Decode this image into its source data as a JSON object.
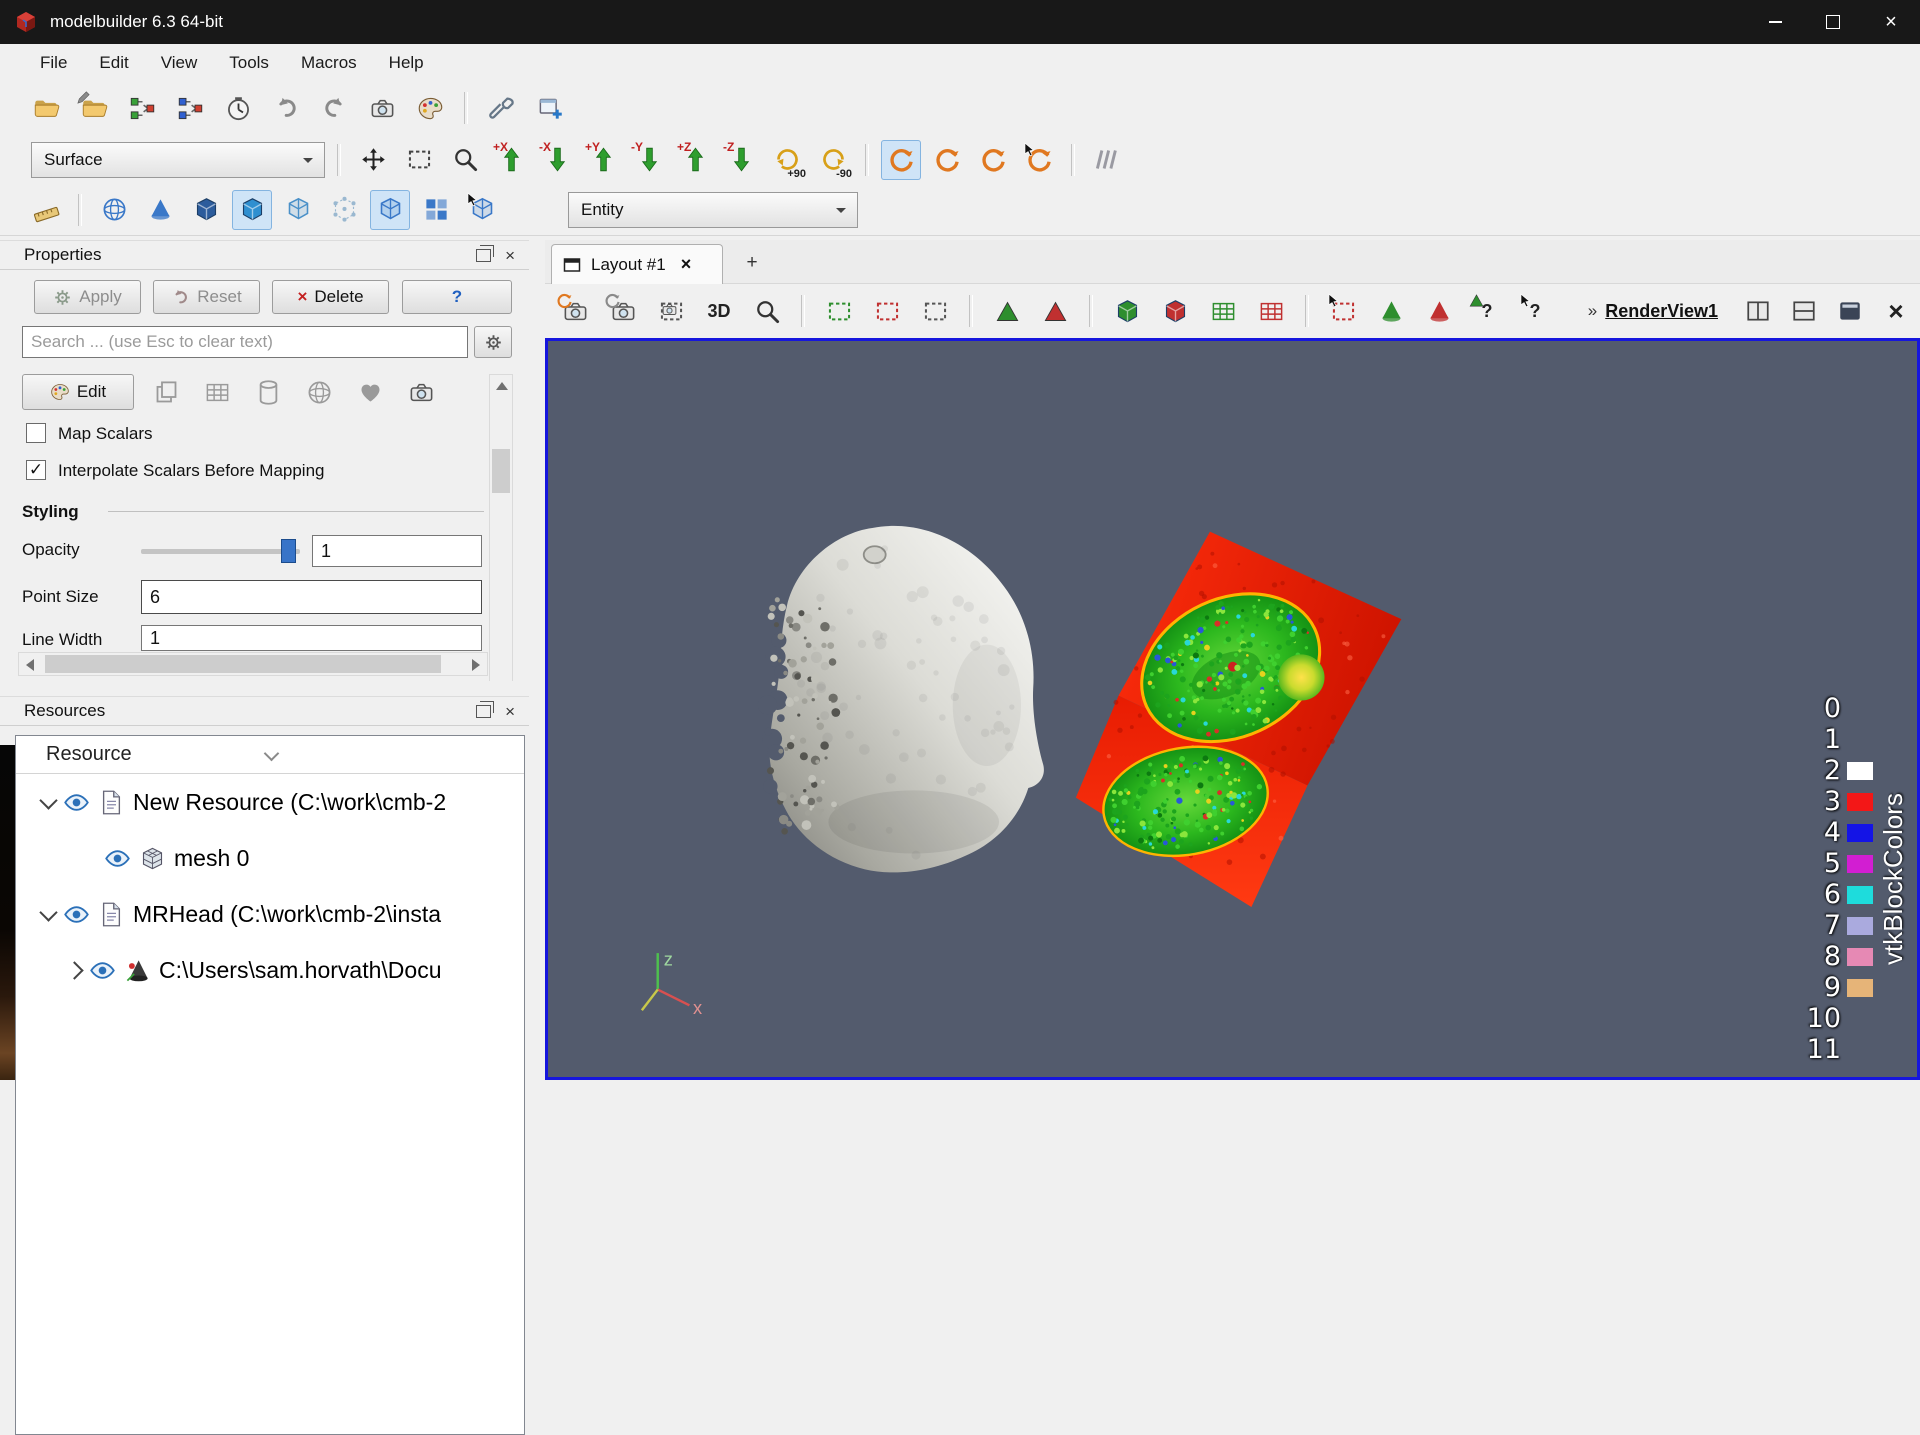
{
  "window": {
    "title": "modelbuilder 6.3 64-bit",
    "controls": {
      "minimize": "minimize",
      "maximize": "maximize",
      "close": "×"
    }
  },
  "menu": {
    "items": [
      "File",
      "Edit",
      "View",
      "Tools",
      "Macros",
      "Help"
    ]
  },
  "toolbars": {
    "representation_value": "Surface",
    "entity_value": "Entity",
    "main": [
      {
        "name": "open-file-button",
        "sym": "s-folder"
      },
      {
        "name": "open-edit-button",
        "sym": "s-folder",
        "overlay": "s-pencil"
      },
      {
        "name": "pipeline-source-button",
        "sym": "s-nodes",
        "color": "#38a038"
      },
      {
        "name": "pipeline-filter-button",
        "sym": "s-nodes",
        "color": "#3060d0"
      },
      {
        "name": "timer-button",
        "sym": "s-clock"
      },
      {
        "name": "undo-button",
        "sym": "s-undo",
        "color": "#8a8a8a"
      },
      {
        "name": "redo-button",
        "sym": "s-undo",
        "color": "#8a8a8a",
        "flip": true
      },
      {
        "name": "camera-link-button",
        "sym": "s-camera"
      },
      {
        "name": "color-palette-button",
        "sym": "s-palette"
      },
      {
        "sep": true
      },
      {
        "name": "tools-wrench-button",
        "sym": "s-wrench"
      },
      {
        "name": "add-view-button",
        "sym": "s-plusdoc"
      }
    ],
    "camera": [
      {
        "name": "zoom-extents-button",
        "sym": "s-expand4",
        "color": "#222222"
      },
      {
        "name": "zoom-closest-button",
        "sym": "s-dashedrect",
        "color": "#444444"
      },
      {
        "name": "zoom-box-button",
        "sym": "s-magnifier",
        "color": "#333333"
      },
      {
        "name": "view-plus-x-button",
        "sym": "s-thickarrow",
        "color": "#2e9e2e",
        "label": "+X"
      },
      {
        "name": "view-minus-x-button",
        "sym": "s-thickarrow",
        "color": "#2e9e2e",
        "rot": 180,
        "label": "-X"
      },
      {
        "name": "view-plus-y-button",
        "sym": "s-thickarrow",
        "color": "#2e9e2e",
        "label": "+Y"
      },
      {
        "name": "view-minus-y-button",
        "sym": "s-thickarrow",
        "color": "#2e9e2e",
        "rot": 180,
        "label": "-Y"
      },
      {
        "name": "view-plus-z-button",
        "sym": "s-thickarrow",
        "color": "#2e9e2e",
        "label": "+Z"
      },
      {
        "name": "view-minus-z-button",
        "sym": "s-thickarrow",
        "color": "#2e9e2e",
        "rot": 180,
        "label": "-Z"
      },
      {
        "name": "rotate-plus-90-button",
        "sym": "s-rot90",
        "color": "#d8a018",
        "label": "+90",
        "lpos": "br"
      },
      {
        "name": "rotate-minus-90-button",
        "sym": "s-rot90",
        "color": "#d8a018",
        "flip": true,
        "label": "-90",
        "lpos": "br"
      },
      {
        "sep": true
      },
      {
        "name": "interaction-3d-button",
        "sym": "s-orbit",
        "color": "#e07820",
        "sel": true
      },
      {
        "name": "interaction-2d-button",
        "sym": "s-orbit",
        "color": "#e07820"
      },
      {
        "name": "interaction-pan-button",
        "sym": "s-orbit",
        "color": "#e07820"
      },
      {
        "name": "interaction-select-button",
        "sym": "s-orbit",
        "color": "#e07820",
        "overlay": "s-cursor"
      },
      {
        "sep": true
      },
      {
        "name": "interaction-mode-button",
        "sym": "s-slashes",
        "color": "#9a9aa2"
      }
    ],
    "representation": [
      {
        "name": "measure-ruler-button",
        "sym": "s-ruler"
      },
      {
        "sep": true
      },
      {
        "name": "show-sphere-grid-button",
        "sym": "s-spheregrid",
        "color": "#3a78c8"
      },
      {
        "name": "show-glyph-button",
        "sym": "s-cone",
        "color": "#3a78c8"
      },
      {
        "name": "solid-cube-button",
        "sym": "s-cube-solid",
        "color": "#2c5c9c"
      },
      {
        "name": "representation-surface-button",
        "sym": "s-cube-solid",
        "color": "#2f8fd0",
        "sel": true
      },
      {
        "name": "representation-wireframe-button",
        "sym": "s-cube",
        "color": "#4a90c8"
      },
      {
        "name": "representation-points-button",
        "sym": "s-cube-points",
        "color": "#9ab8d0"
      },
      {
        "name": "representation-edges-button",
        "sym": "s-cube",
        "color": "#3a78c8",
        "sel": true
      },
      {
        "name": "glyph-dots-button",
        "sym": "s-glyphdots",
        "color": "#3a78c8"
      },
      {
        "name": "select-entity-button",
        "sym": "s-cube",
        "color": "#3a78c8",
        "overlay": "s-cursor"
      }
    ],
    "render_view": [
      {
        "name": "reset-camera-button",
        "sym": "s-camera",
        "overlay": "s-orbit",
        "ocolor": "#e07820"
      },
      {
        "name": "capture-view-button",
        "sym": "s-camera",
        "overlay": "s-orbit",
        "ocolor": "#8a8a8a"
      },
      {
        "name": "save-screenshot-button",
        "sym": "s-dashedrect",
        "color": "#555555",
        "overlay": "s-camera",
        "opos": "c"
      },
      {
        "name": "toggle-2d-3d-button",
        "text": "3D"
      },
      {
        "name": "zoom-to-data-button",
        "sym": "s-magnifier",
        "color": "#333333"
      },
      {
        "sep": true
      },
      {
        "name": "select-cells-on-button",
        "sym": "s-dashedrect",
        "color": "#2e8e2e"
      },
      {
        "name": "select-points-on-button",
        "sym": "s-dashedrect",
        "color": "#c03030"
      },
      {
        "name": "select-cells-polygon-button",
        "sym": "s-dashedrect",
        "color": "#555555"
      },
      {
        "sep": true
      },
      {
        "name": "select-cells-through-button",
        "sym": "s-tri",
        "color": "#2e8e2e"
      },
      {
        "name": "select-points-through-button",
        "sym": "s-tri",
        "color": "#c03030"
      },
      {
        "sep": true
      },
      {
        "name": "select-block-button",
        "sym": "s-cube-solid",
        "color": "#2e8e2e"
      },
      {
        "name": "select-block-points-button",
        "sym": "s-cube-solid",
        "color": "#c03030"
      },
      {
        "name": "select-frustum-cells-button",
        "sym": "s-grid3",
        "color": "#2e8e2e"
      },
      {
        "name": "select-frustum-points-button",
        "sym": "s-grid3",
        "color": "#c03030"
      },
      {
        "sep": true
      },
      {
        "name": "interactive-select-cells-button",
        "sym": "s-dashedrect",
        "color": "#c03030",
        "overlay": "s-cursor"
      },
      {
        "name": "hover-cells-button",
        "sym": "s-cone",
        "color": "#2e8e2e"
      },
      {
        "name": "hover-points-button",
        "sym": "s-cone",
        "color": "#c03030"
      },
      {
        "name": "query-cells-button",
        "text": "?",
        "sym": "s-tri",
        "color": "#2e8e2e",
        "opos": "c"
      },
      {
        "name": "query-points-button",
        "text": "?",
        "overlay": "s-cursor"
      }
    ],
    "edit_row": [
      {
        "name": "copy-representation-button",
        "sym": "s-copy",
        "color": "#9a9a9a"
      },
      {
        "name": "grid-representation-button",
        "sym": "s-grid3",
        "color": "#9a9a9a"
      },
      {
        "name": "cylinder-representation-button",
        "sym": "s-cylinder",
        "color": "#9a9a9a"
      },
      {
        "name": "sphere-representation-button",
        "sym": "s-spheregrid",
        "color": "#9a9a9a"
      },
      {
        "name": "favorite-representation-button",
        "sym": "s-heart",
        "color": "#9a9a9a"
      },
      {
        "name": "snapshot-representation-button",
        "sym": "s-camera",
        "color": "#9a9a9a"
      }
    ]
  },
  "properties": {
    "title": "Properties",
    "apply": "Apply",
    "reset": "Reset",
    "delete": "Delete",
    "help": "?",
    "search_placeholder": "Search ... (use Esc to clear text)",
    "edit": "Edit",
    "map_scalars": {
      "label": "Map Scalars",
      "checked": false
    },
    "interpolate": {
      "label": "Interpolate Scalars Before Mapping",
      "checked": true
    },
    "styling": "Styling",
    "opacity_label": "Opacity",
    "opacity_value": "1",
    "point_size_label": "Point Size",
    "point_size_value": "6",
    "line_width_label": "Line Width",
    "line_width_value": "1"
  },
  "resources": {
    "title": "Resources",
    "column": "Resource",
    "items": [
      {
        "label": "New Resource (C:\\work\\cmb-2",
        "indent": 0,
        "expander": "open",
        "icon": "s-file"
      },
      {
        "label": "mesh 0",
        "indent": 1,
        "expander": "none",
        "icon": "s-meshcube"
      },
      {
        "label": "MRHead (C:\\work\\cmb-2\\insta",
        "indent": 0,
        "expander": "open",
        "icon": "s-file"
      },
      {
        "label": "C:\\Users\\sam.horvath\\Docu",
        "indent": 1,
        "expander": "closed",
        "icon": "s-glyphcone"
      }
    ]
  },
  "layout": {
    "tab_label": "Layout #1",
    "add_tab": "+"
  },
  "render_view_bar": {
    "overflow": "»",
    "label": "RenderView1"
  },
  "viewport": {
    "background": "#535b6d",
    "border_color": "#1616dd",
    "axes": {
      "x": "x",
      "z": "z"
    },
    "legend": {
      "title": "vtkBlockColors",
      "entries": [
        {
          "label": "0",
          "color": null
        },
        {
          "label": "1",
          "color": null
        },
        {
          "label": "2",
          "color": "#ffffff"
        },
        {
          "label": "3",
          "color": "#f31717"
        },
        {
          "label": "4",
          "color": "#1414e6"
        },
        {
          "label": "5",
          "color": "#d21ed2"
        },
        {
          "label": "6",
          "color": "#1edcdc"
        },
        {
          "label": "7",
          "color": "#aaaade"
        },
        {
          "label": "8",
          "color": "#e689b4"
        },
        {
          "label": "9",
          "color": "#e6b478"
        },
        {
          "label": "10",
          "color": null
        },
        {
          "label": "11",
          "color": null
        }
      ]
    }
  }
}
